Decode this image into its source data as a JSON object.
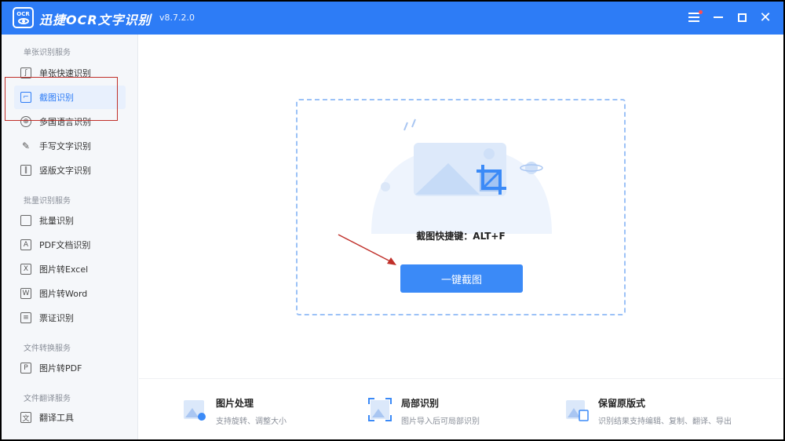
{
  "titlebar": {
    "logo_text": "OCR",
    "app_title": "迅捷OCR文字识别",
    "version": "v8.7.2.0"
  },
  "sidebar": {
    "section1": "单张识别服务",
    "section2": "批量识别服务",
    "section3": "文件转换服务",
    "section4": "文件翻译服务",
    "items": [
      {
        "label": "单张快速识别",
        "icon": "single-scan-icon"
      },
      {
        "label": "截图识别",
        "icon": "crop-icon"
      },
      {
        "label": "多国语言识别",
        "icon": "globe-icon"
      },
      {
        "label": "手写文字识别",
        "icon": "pen-icon"
      },
      {
        "label": "竖版文字识别",
        "icon": "vertical-text-icon"
      },
      {
        "label": "批量识别",
        "icon": "batch-icon"
      },
      {
        "label": "PDF文档识别",
        "icon": "pdf-icon"
      },
      {
        "label": "图片转Excel",
        "icon": "excel-icon"
      },
      {
        "label": "图片转Word",
        "icon": "word-icon"
      },
      {
        "label": "票证识别",
        "icon": "ticket-icon"
      },
      {
        "label": "图片转PDF",
        "icon": "pdf-convert-icon"
      },
      {
        "label": "翻译工具",
        "icon": "translate-icon"
      }
    ]
  },
  "main": {
    "shortcut_text": "截图快捷键：ALT+F",
    "capture_button": "一键截图"
  },
  "features": [
    {
      "title": "图片处理",
      "desc": "支持旋转、调整大小"
    },
    {
      "title": "局部识别",
      "desc": "图片导入后可局部识别"
    },
    {
      "title": "保留原版式",
      "desc": "识别结果支持编辑、复制、翻译、导出"
    }
  ],
  "colors": {
    "accent": "#2d7cf6",
    "button": "#3b8af7",
    "annotation": "#c0302a"
  }
}
